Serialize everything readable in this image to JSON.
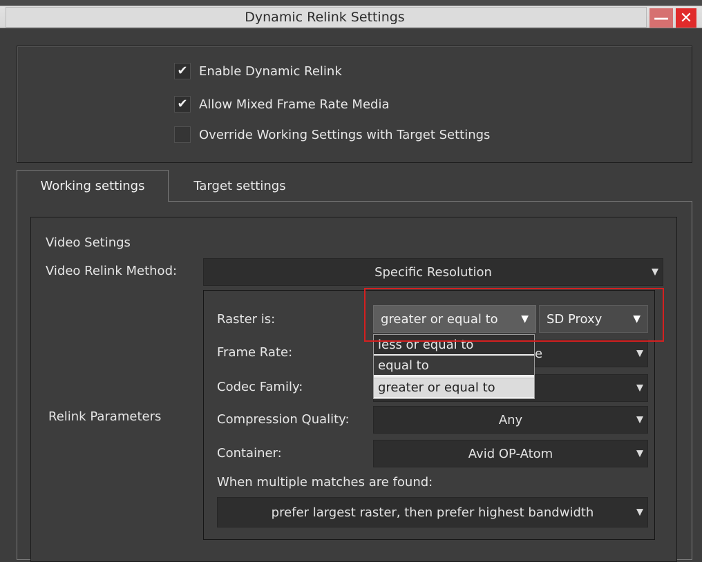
{
  "window": {
    "title": "Dynamic Relink Settings",
    "minimize_glyph": "—",
    "close_glyph": "✕"
  },
  "options": [
    {
      "label": "Enable Dynamic Relink",
      "checked": true
    },
    {
      "label": "Allow Mixed Frame Rate Media",
      "checked": true
    },
    {
      "label": "Override Working Settings with Target Settings",
      "checked": false
    }
  ],
  "tabs": [
    {
      "label": "Working settings",
      "active": true
    },
    {
      "label": "Target settings",
      "active": false
    }
  ],
  "video": {
    "section_title": "Video Setings",
    "relink_method_label": "Video Relink Method:",
    "relink_method_value": "Specific Resolution",
    "relink_parameters_label": "Relink Parameters"
  },
  "params": {
    "raster_label": "Raster is:",
    "raster_operator": "greater or equal to",
    "raster_value": "SD Proxy",
    "frame_rate_label": "Frame Rate:",
    "frame_rate_value_partial": "le",
    "codec_family_label": "Codec Family:",
    "compression_quality_label": "Compression Quality:",
    "compression_quality_value": "Any",
    "container_label": "Container:",
    "container_value": "Avid OP-Atom",
    "multiple_matches_label": "When multiple matches are found:",
    "multiple_matches_value": "prefer largest raster, then prefer highest bandwidth"
  },
  "raster_dropdown": {
    "options": [
      "less or equal to",
      "equal to",
      "greater or equal to"
    ],
    "selected": "greater or equal to"
  },
  "icons": {
    "dropdown_arrow": "▼",
    "check": "✔"
  },
  "colors": {
    "background": "#3d3d3d",
    "close_button": "#e02b2b",
    "highlight": "#d42020"
  }
}
